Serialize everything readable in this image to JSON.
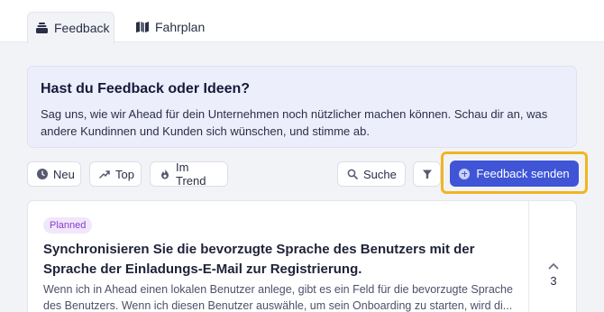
{
  "tabs": [
    {
      "label": "Feedback",
      "icon": "inbox-stack-icon",
      "active": true
    },
    {
      "label": "Fahrplan",
      "icon": "map-icon",
      "active": false
    }
  ],
  "info": {
    "title": "Hast du Feedback oder Ideen?",
    "text": "Sag uns, wie wir Ahead für dein Unternehmen noch nützlicher machen können. Schau dir an, was andere Kundinnen und Kunden sich wünschen, und stimme ab."
  },
  "filters": {
    "new_label": "Neu",
    "top_label": "Top",
    "trend_label": "Im Trend",
    "search_label": "Suche"
  },
  "cta": {
    "label": "Feedback senden",
    "highlight_color": "#f2b51f"
  },
  "posts": [
    {
      "status": "Planned",
      "title": "Synchronisieren Sie die bevorzugte Sprache des Benutzers mit der Sprache der Einladungs-E-Mail zur Registrierung.",
      "description": "Wenn ich in Ahead einen lokalen Benutzer anlege, gibt es ein Feld für die bevorzugte Sprache des Benutzers. Wenn ich diesen Benutzer auswähle, um sein Onboarding zu starten, wird di...",
      "votes": "3"
    }
  ],
  "colors": {
    "accent": "#3f55d6",
    "status_planned": "#8a3ccf",
    "info_bg": "#edeefb"
  }
}
